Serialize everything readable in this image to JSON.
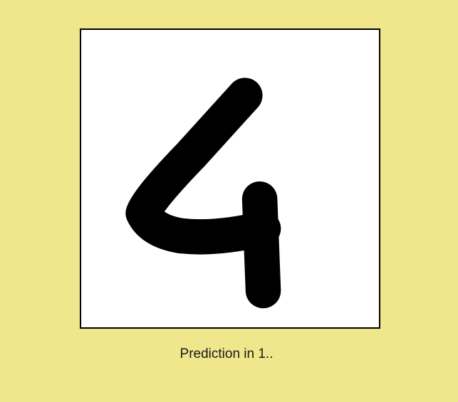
{
  "prediction": {
    "text": "Prediction in 1.."
  },
  "canvas": {
    "background_color": "#ffffff",
    "border_color": "#000000",
    "stroke_color": "#000000",
    "drawing_icon": "handwritten-digit-drawing"
  },
  "page": {
    "background_color": "#F0E68C"
  }
}
